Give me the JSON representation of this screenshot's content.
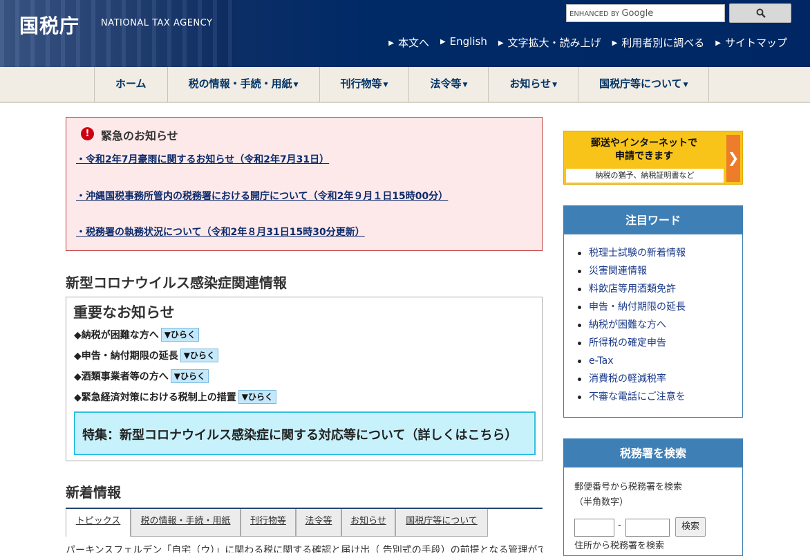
{
  "header": {
    "logo_title": "国税庁",
    "logo_en": "NATIONAL TAX AGENCY",
    "search_brand_prefix": "ENHANCED BY",
    "search_brand_name": "Google",
    "util_links": [
      "本文へ",
      "English",
      "文字拡大・読み上げ",
      "利用者別に調べる",
      "サイトマップ"
    ]
  },
  "gnav": [
    {
      "label": "ホーム",
      "dropdown": false
    },
    {
      "label": "税の情報・手続・用紙",
      "dropdown": true
    },
    {
      "label": "刊行物等",
      "dropdown": true
    },
    {
      "label": "法令等",
      "dropdown": true
    },
    {
      "label": "お知らせ",
      "dropdown": true
    },
    {
      "label": "国税庁等について",
      "dropdown": true
    }
  ],
  "alert": {
    "title": "緊急のお知らせ",
    "links": [
      "・令和2年7月豪雨に関するお知らせ（令和2年7月31日）",
      "・沖縄国税事務所管内の税務署における開庁について（令和2年９月１日15時00分）",
      "・税務署の執務状況について（令和2年８月31日15時30分更新）"
    ]
  },
  "covid": {
    "title": "新型コロナウイルス感染症関連情報",
    "important_title": "重要なお知らせ",
    "items": [
      "◆納税が困難な方へ",
      "◆申告・納付期限の延長",
      "◆酒類事業者等の方へ",
      "◆緊急経済対策における税制上の措置"
    ],
    "open_label": "▼ひらく",
    "feature_text": "特集：新型コロナウイルス感染症に関する対応等について（詳しくはこちら）"
  },
  "news": {
    "title": "新着情報",
    "tabs": [
      "トピックス",
      "税の情報・手続・用紙",
      "刊行物等",
      "法令等",
      "お知らせ",
      "国税庁等について"
    ],
    "cut_text": "パーキンスフェルデン「自宅（ウ）」に関わる税に関する確認と届け出（ 告別式の手段）の前提となる管理ができた・・"
  },
  "sidebar": {
    "banner": {
      "line1": "郵送やインターネットで",
      "line2": "申請できます",
      "sub": "納税の猶予、納税証明書など",
      "arrow": "❯"
    },
    "keywords": {
      "title": "注目ワード",
      "items": [
        "税理士試験の新着情報",
        "災害関連情報",
        "料飲店等用酒類免許",
        "申告・納付期限の延長",
        "納税が困難な方へ",
        "所得税の確定申告",
        "e-Tax",
        "消費税の軽減税率",
        "不審な電話にご注意を"
      ]
    },
    "office_search": {
      "title": "税務署を検索",
      "zip_label": "郵便番号から税務署を検索",
      "zip_note": "（半角数字）",
      "dash": "-",
      "button": "検索",
      "address_label": "住所から税務署を検索"
    }
  }
}
